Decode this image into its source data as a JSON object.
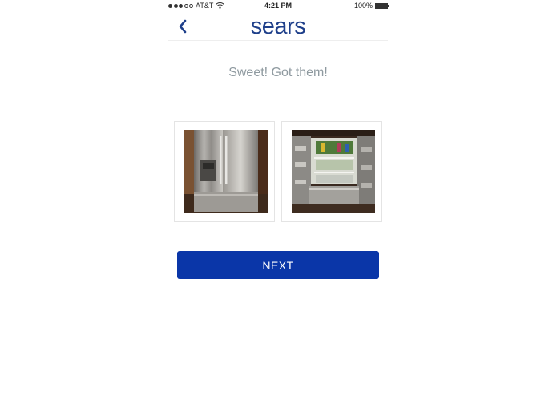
{
  "status_bar": {
    "carrier": "AT&T",
    "time": "4:21 PM",
    "battery": "100%",
    "signal_icon": "signal-dots-icon",
    "wifi_icon": "wifi-icon",
    "battery_icon": "battery-icon"
  },
  "header": {
    "back_icon": "chevron-left-icon",
    "logo_text": "sears"
  },
  "main": {
    "message": "Sweet! Got them!",
    "photos": [
      "photo-fridge-closed",
      "photo-fridge-open"
    ],
    "next_label": "NEXT"
  },
  "colors": {
    "brand_blue": "#0a36a8",
    "logo_blue": "#1e3f8a",
    "message_gray": "#8f9aa0"
  }
}
